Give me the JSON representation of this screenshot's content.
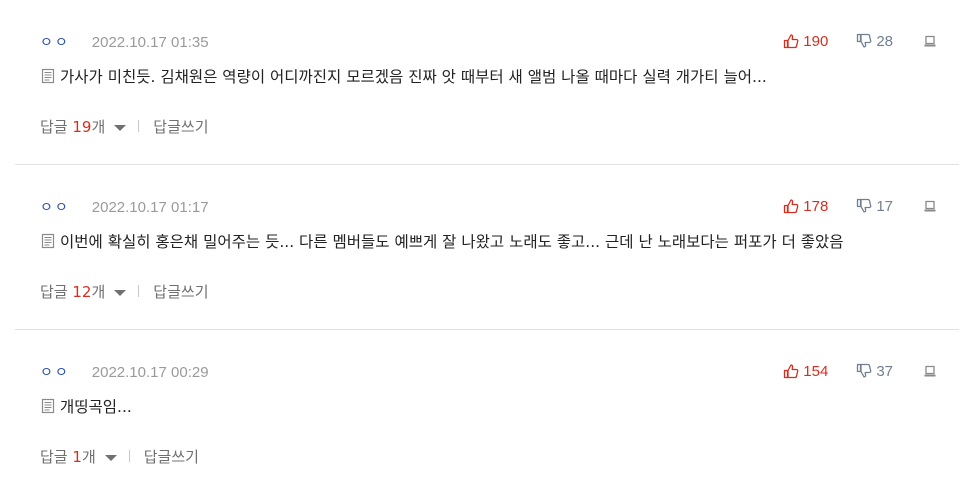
{
  "colors": {
    "nickname": "#2a4ea8",
    "date": "#9a9a9a",
    "up_vote": "#d92d20",
    "down_vote": "#6f7f91",
    "reply_count": "#d92d20",
    "divider": "#e2e2e2"
  },
  "icons": {
    "up": "thumbs-up-icon",
    "down": "thumbs-down-icon",
    "report": "report-icon",
    "memo": "memo-icon",
    "toggle": "caret-down-icon"
  },
  "comments": [
    {
      "nickname": "ㅇㅇ",
      "date": "2022.10.17 01:35",
      "up": "190",
      "down": "28",
      "text": "가사가 미친듯. 김채원은 역량이 어디까진지 모르겠음 진짜 앗 때부터 새 앨범 나올 때마다 실력 개가티 늘어...",
      "reply_label": "답글",
      "reply_count": "19",
      "reply_unit": "개",
      "write_reply": "답글쓰기"
    },
    {
      "nickname": "ㅇㅇ",
      "date": "2022.10.17 01:17",
      "up": "178",
      "down": "17",
      "text": "이번에 확실히 홍은채 밀어주는 듯... 다른 멤버들도 예쁘게 잘 나왔고 노래도 좋고... 근데 난 노래보다는 퍼포가 더 좋았음",
      "reply_label": "답글",
      "reply_count": "12",
      "reply_unit": "개",
      "write_reply": "답글쓰기"
    },
    {
      "nickname": "ㅇㅇ",
      "date": "2022.10.17 00:29",
      "up": "154",
      "down": "37",
      "text": "개띵곡임...",
      "reply_label": "답글",
      "reply_count": "1",
      "reply_unit": "개",
      "write_reply": "답글쓰기"
    }
  ]
}
